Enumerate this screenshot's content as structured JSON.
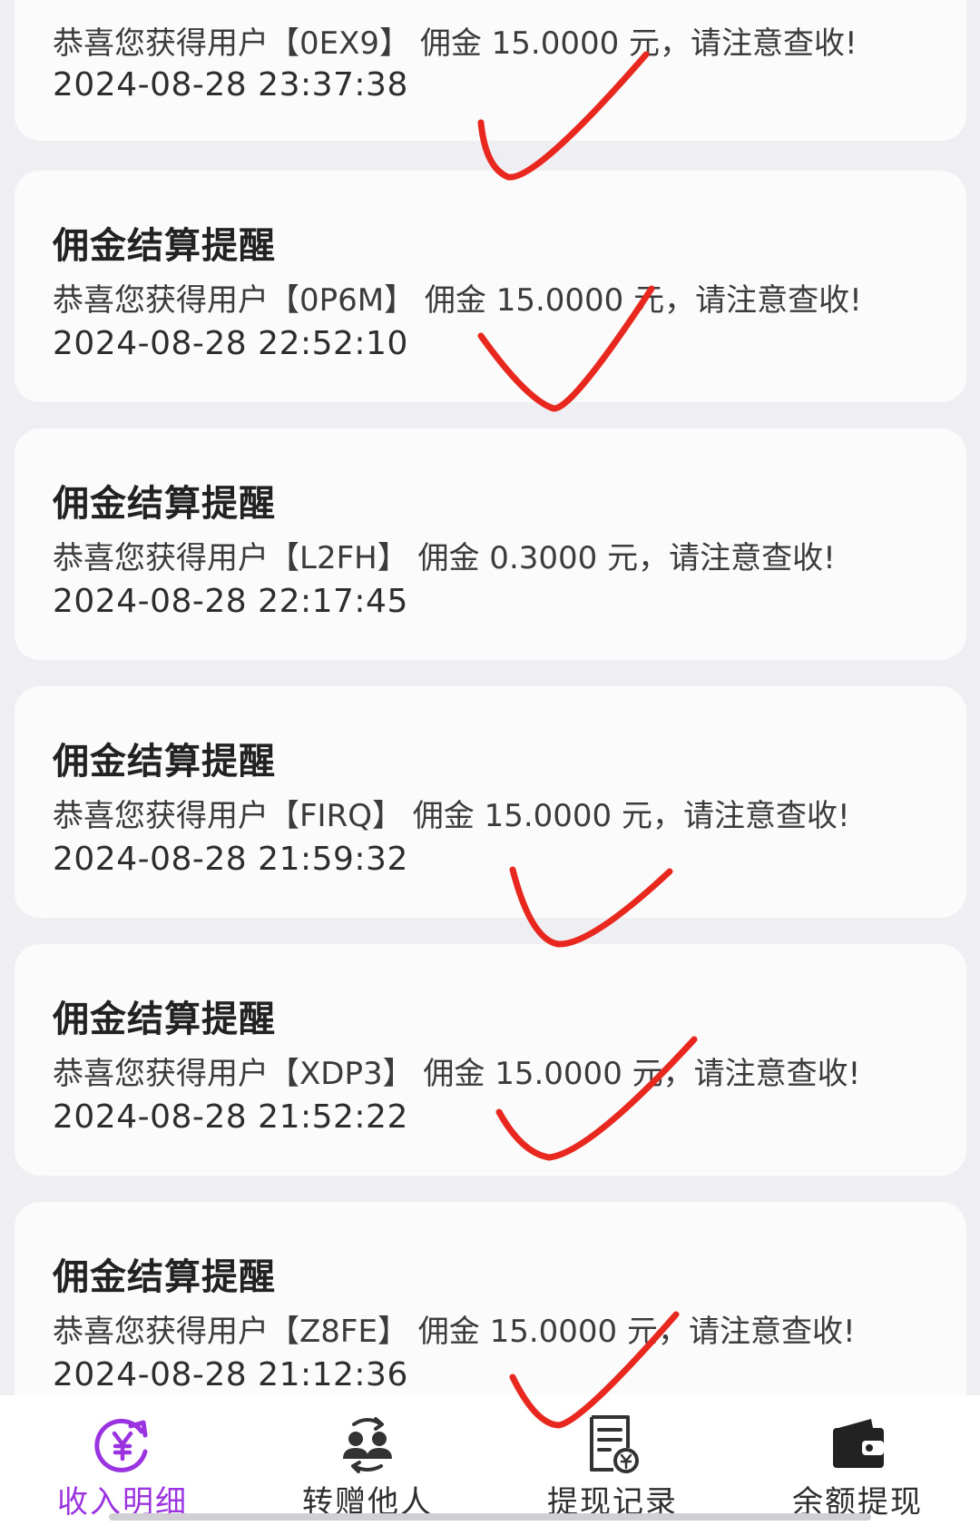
{
  "notifications": [
    {
      "title": "",
      "message": "恭喜您获得用户【0EX9】 佣金 15.0000 元，请注意查收!",
      "time": "2024-08-28 23:37:38"
    },
    {
      "title": "佣金结算提醒",
      "message": "恭喜您获得用户【0P6M】 佣金 15.0000 元，请注意查收!",
      "time": "2024-08-28 22:52:10"
    },
    {
      "title": "佣金结算提醒",
      "message": "恭喜您获得用户【L2FH】 佣金 0.3000 元，请注意查收!",
      "time": "2024-08-28 22:17:45"
    },
    {
      "title": "佣金结算提醒",
      "message": "恭喜您获得用户【FIRQ】 佣金 15.0000 元，请注意查收!",
      "time": "2024-08-28 21:59:32"
    },
    {
      "title": "佣金结算提醒",
      "message": "恭喜您获得用户【XDP3】 佣金 15.0000 元，请注意查收!",
      "time": "2024-08-28 21:52:22"
    },
    {
      "title": "佣金结算提醒",
      "message": "恭喜您获得用户【Z8FE】 佣金 15.0000 元，请注意查收!",
      "time": "2024-08-28 21:12:36"
    }
  ],
  "tabs": [
    {
      "label": "收入明细",
      "icon": "income-yuan-icon",
      "active": true
    },
    {
      "label": "转赠他人",
      "icon": "transfer-users-icon",
      "active": false
    },
    {
      "label": "提现记录",
      "icon": "withdraw-record-icon",
      "active": false
    },
    {
      "label": "余额提现",
      "icon": "wallet-icon",
      "active": false
    }
  ],
  "colors": {
    "active_tab": "#9b34e0",
    "check_mark": "#e8281e",
    "background": "#efeef2",
    "card": "#fbfbfc"
  }
}
